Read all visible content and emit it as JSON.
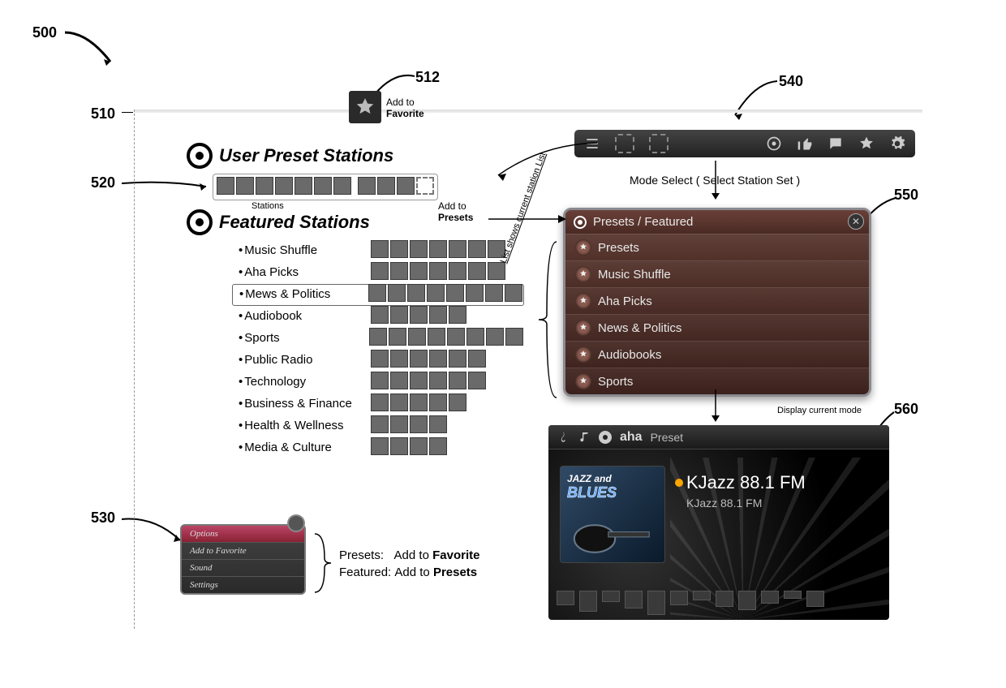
{
  "refs": {
    "r500": "500",
    "r510": "510",
    "r512": "512",
    "r520": "520",
    "r530": "530",
    "r540": "540",
    "r550": "550",
    "r560": "560"
  },
  "fav": {
    "add_line1": "Add to",
    "add_line2": "Favorite"
  },
  "preset_add": {
    "line1": "Add to",
    "line2": "Presets"
  },
  "section": {
    "user_presets": "User Preset Stations",
    "featured": "Featured Stations",
    "stations_label": "Stations"
  },
  "featured_items": [
    {
      "label": "Music Shuffle",
      "tiles": 7
    },
    {
      "label": "Aha Picks",
      "tiles": 7
    },
    {
      "label": "Mews & Politics",
      "tiles": 8,
      "boxed": true
    },
    {
      "label": "Audiobook",
      "tiles": 5
    },
    {
      "label": "Sports",
      "tiles": 8
    },
    {
      "label": "Public Radio",
      "tiles": 6
    },
    {
      "label": "Technology",
      "tiles": 6
    },
    {
      "label": "Business & Finance",
      "tiles": 5
    },
    {
      "label": "Health & Wellness",
      "tiles": 4
    },
    {
      "label": "Media & Culture",
      "tiles": 4
    }
  ],
  "options_popup": {
    "rows": [
      "Options",
      "Add to Favorite",
      "Sound",
      "Settings"
    ]
  },
  "options_note": {
    "l1a": "Presets:",
    "l1b": "Add to Favorite",
    "l2a": "Featured:",
    "l2b": "Add to Presets"
  },
  "mode_select_label": "Mode Select ( Select Station Set )",
  "mode_panel": {
    "header": "Presets / Featured",
    "items": [
      "Presets",
      "Music Shuffle",
      "Aha Picks",
      "News & Politics",
      "Audiobooks",
      "Sports"
    ]
  },
  "display_mode_label": "Display current mode",
  "player": {
    "brand": "aha",
    "mode": "Preset",
    "art_l1": "JAZZ and",
    "art_l2": "BLUES",
    "title": "KJazz 88.1 FM",
    "subtitle": "KJazz 88.1 FM"
  },
  "rot_label": "List shows current station List"
}
